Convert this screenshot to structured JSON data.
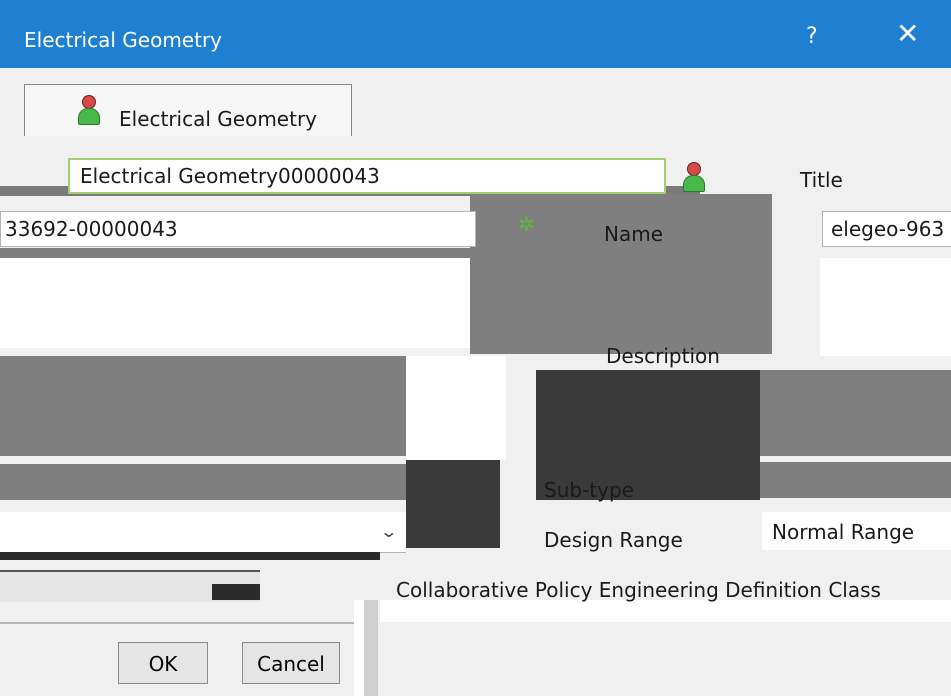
{
  "dialog": {
    "title": "Electrical Geometry",
    "help_label": "?",
    "close_label": "✕"
  },
  "tab": {
    "label": "Electrical Geometry"
  },
  "header": {
    "field_value": "Electrical Geometry00000043"
  },
  "fields": {
    "title_label": "Title",
    "name_label": "Name",
    "name_value_left": "33692-00000043",
    "name_value_right": "elegeo-963",
    "description_label": "Description",
    "subtype_label": "Sub-type",
    "design_range_label": "Design Range",
    "design_range_value": "Normal Range",
    "collaborative_policy_label": "Collaborative Policy",
    "collaborative_policy_value": "Engineering Definition Class"
  },
  "buttons": {
    "ok_label": "OK",
    "cancel_label": "Cancel"
  },
  "colors": {
    "titlebar": "#1f7fd1",
    "field_border_focus": "#9ed16e",
    "panel_dark": "#3a3a3a",
    "panel_gray": "#7f7f7f"
  }
}
